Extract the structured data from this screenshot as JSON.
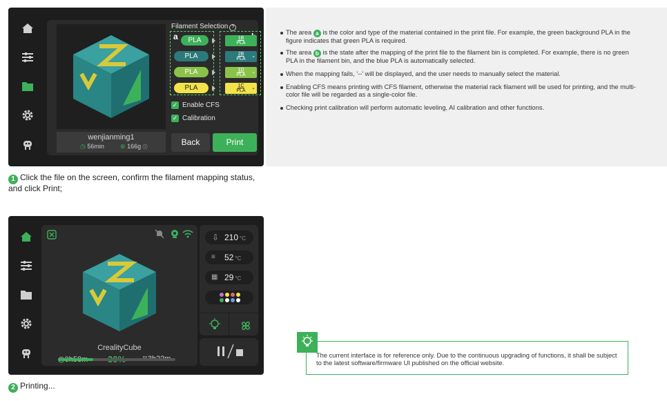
{
  "screen1": {
    "sidebar_icons": [
      "home-icon",
      "sliders-icon",
      "folder-icon",
      "gear-icon",
      "robot-icon"
    ],
    "filament_selection_title": "Filament Selection",
    "mappings": [
      {
        "source": "PLA",
        "source_color": "#3db15a",
        "bin_slot": "1B",
        "bin_type": "PLA",
        "bin_color": "#3db15a",
        "has_dropdown": false
      },
      {
        "source": "PLA",
        "source_color": "#2c7a7b",
        "bin_slot": "2B",
        "bin_type": "PLA",
        "bin_color": "#2c7a7b",
        "has_dropdown": true
      },
      {
        "source": "PLA",
        "source_color": "#8bc34a",
        "bin_slot": "1D",
        "bin_type": "PLA",
        "bin_color": "#8bc34a",
        "has_dropdown": true
      },
      {
        "source": "PLA",
        "source_color": "#f2e34a",
        "bin_slot": "1C",
        "bin_type": "PLA",
        "bin_color": "#f2e34a",
        "has_dropdown": true
      }
    ],
    "area_a_tag": "a",
    "area_b_tag": "b",
    "enable_cfs_label": "Enable CFS",
    "calibration_label": "Calibration",
    "file_name": "wenjianming1",
    "print_time": "56min",
    "weight": "166g",
    "back_label": "Back",
    "print_label": "Print"
  },
  "notes": [
    {
      "pre": "The area ",
      "badge": "a",
      "post": " is the color and type of the material contained in the print file. For example, the green background PLA in the figure indicates that green PLA is required."
    },
    {
      "pre": "The area ",
      "badge": "b",
      "post": " is the state after the mapping of the print file to the filament bin is completed. For example, there is no green PLA in the filament bin, and the blue PLA is automatically selected."
    },
    {
      "pre": "When the mapping fails, '--' will be displayed, and the user needs to manually select the material.",
      "badge": "",
      "post": ""
    },
    {
      "pre": "Enabling CFS means printing with CFS filament, otherwise the material rack filament will be used for printing, and the multi-color file will be regarded as a single-color file.",
      "badge": "",
      "post": ""
    },
    {
      "pre": "Checking print calibration will perform automatic leveling, AI calibration and other functions.",
      "badge": "",
      "post": ""
    }
  ],
  "step1": {
    "num": "1",
    "text": "Click the file on the screen, confirm the filament mapping status, and click Print;"
  },
  "screen2": {
    "file_name": "CrealityCube",
    "elapsed": "0h58m",
    "progress_text": "30%",
    "progress_fraction": 0.3,
    "remaining": "3h22m",
    "nozzle_temp": "210",
    "bed_temp": "52",
    "chamber_temp": "29",
    "temp_unit": "°C",
    "pause_stop_label": "II/■"
  },
  "step2": {
    "num": "2",
    "text": "Printing..."
  },
  "tip": "The current interface is for reference only. Due to the continuous upgrading of functions, it shall be subject to the latest software/firmware UI published on the official website.",
  "colors": {
    "accent": "#3db15a",
    "screen_bg": "#1d1d1d",
    "panel_bg": "#2b2b2b",
    "notes_bg": "#f0f0f0"
  }
}
